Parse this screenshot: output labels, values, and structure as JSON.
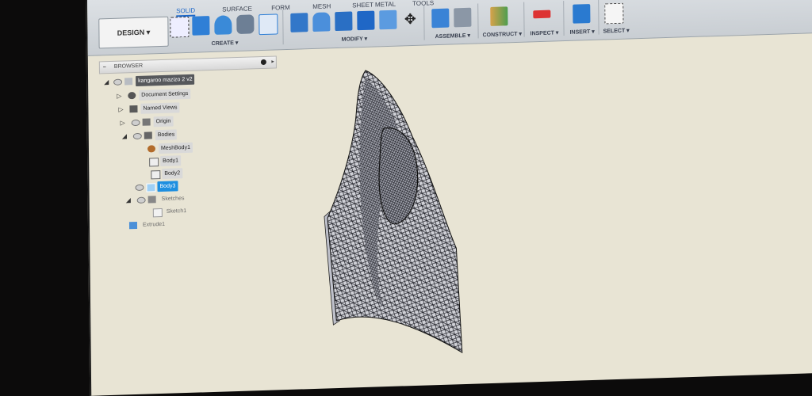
{
  "toolbar": {
    "workspace_button": "DESIGN ▾",
    "tabs": [
      "SOLID",
      "SURFACE",
      "FORM",
      "MESH",
      "SHEET METAL",
      "TOOLS"
    ],
    "groups": [
      "CREATE ▾",
      "MODIFY ▾",
      "ASSEMBLE ▾",
      "CONSTRUCT ▾",
      "INSPECT ▾",
      "INSERT ▾",
      "SELECT ▾"
    ]
  },
  "browser": {
    "title": "BROWSER",
    "items": [
      {
        "label": "kangaroo mazizo 2 v2",
        "level": 0,
        "icon": "document-icon"
      },
      {
        "label": "Document Settings",
        "level": 1,
        "icon": "gear-icon"
      },
      {
        "label": "Named Views",
        "level": 1,
        "icon": "folder-icon"
      },
      {
        "label": "Origin",
        "level": 1,
        "icon": "folder-icon"
      },
      {
        "label": "Bodies",
        "level": 1,
        "icon": "folder-icon"
      },
      {
        "label": "MeshBody1",
        "level": 2,
        "icon": "mesh-body-icon"
      },
      {
        "label": "Body1",
        "level": 2,
        "icon": "body-icon"
      },
      {
        "label": "Body2",
        "level": 2,
        "icon": "body-icon"
      },
      {
        "label": "Body3",
        "level": 2,
        "icon": "body-icon"
      },
      {
        "label": "Sketches",
        "level": 1,
        "icon": "folder-icon"
      },
      {
        "label": "Sketch1",
        "level": 2,
        "icon": "sketch-icon"
      },
      {
        "label": "Extrude1",
        "level": 1,
        "icon": "extrude-icon"
      }
    ]
  },
  "colors": {
    "accent": "#1b66c9",
    "selection": "#1e8fe0",
    "canvas": "#e8e4d4",
    "mesh": "#15161c"
  }
}
